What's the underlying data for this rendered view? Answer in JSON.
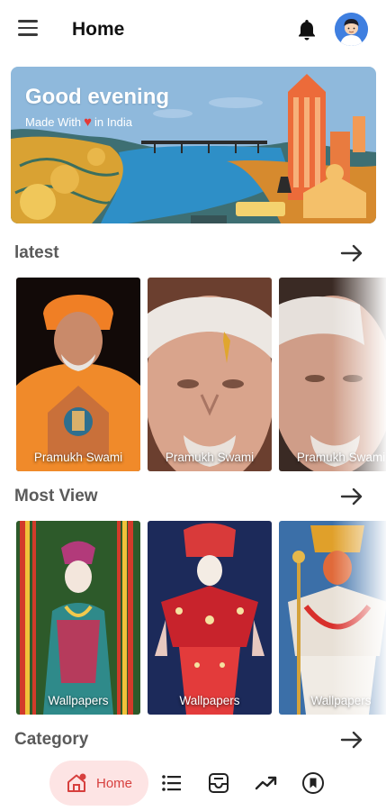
{
  "appbar": {
    "title": "Home"
  },
  "banner": {
    "greeting": "Good evening",
    "tagline_prefix": "Made With",
    "tagline_suffix": "in India"
  },
  "sections": {
    "latest": {
      "title": "latest",
      "items": [
        {
          "label": "Pramukh Swami"
        },
        {
          "label": "Pramukh Swami"
        },
        {
          "label": "Pramukh Swami"
        }
      ]
    },
    "most_view": {
      "title": "Most View",
      "items": [
        {
          "label": "Wallpapers"
        },
        {
          "label": "Wallpapers"
        },
        {
          "label": "Wallpapers"
        }
      ]
    },
    "category": {
      "title": "Category"
    }
  },
  "bottom_nav": {
    "home_label": "Home"
  },
  "colors": {
    "accent": "#d7403e",
    "accent_bg": "#fde4e4",
    "section_title": "#5a5a5a"
  }
}
